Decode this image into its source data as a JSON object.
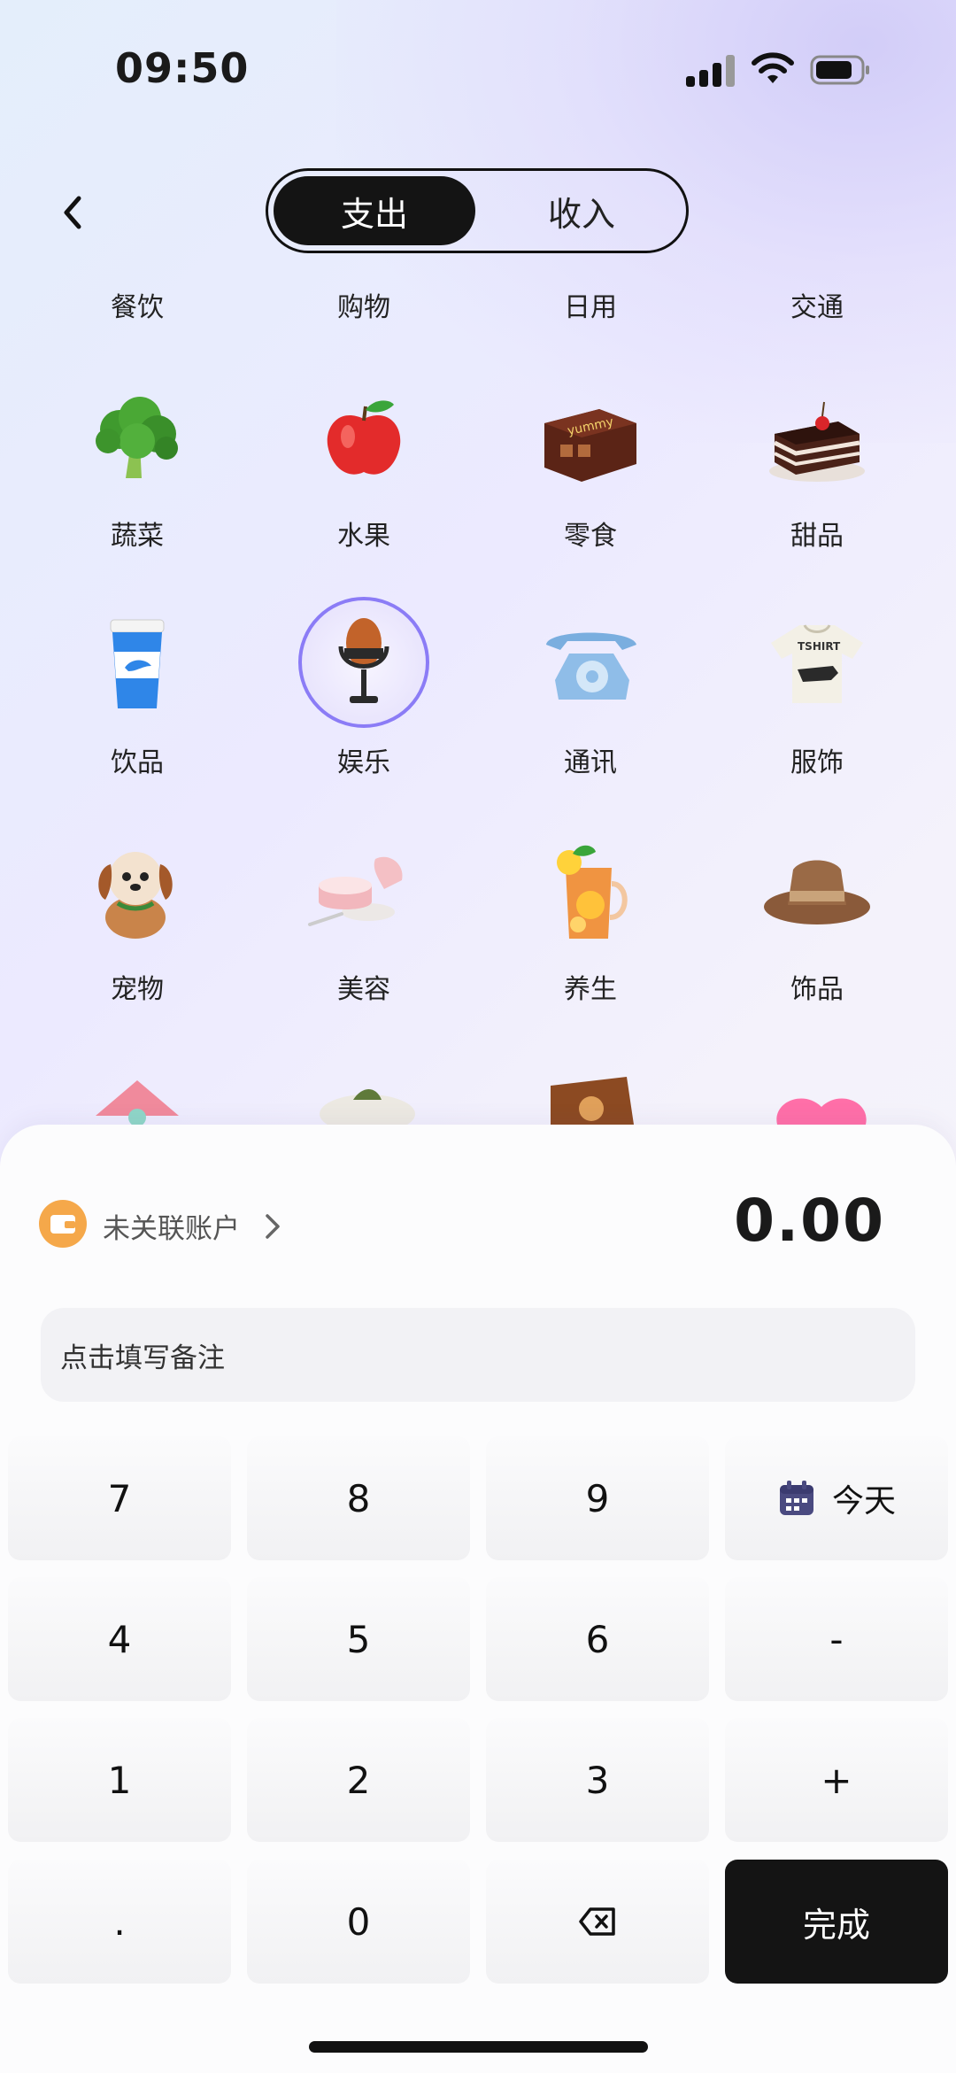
{
  "status": {
    "time": "09:50"
  },
  "segment": {
    "expense": "支出",
    "income": "收入"
  },
  "top_categories": [
    "餐饮",
    "购物",
    "日用",
    "交通"
  ],
  "categories": [
    {
      "label": "蔬菜",
      "icon": "broccoli-icon"
    },
    {
      "label": "水果",
      "icon": "apple-icon"
    },
    {
      "label": "零食",
      "icon": "snack-box-icon"
    },
    {
      "label": "甜品",
      "icon": "cake-icon"
    },
    {
      "label": "饮品",
      "icon": "coffee-cup-icon"
    },
    {
      "label": "娱乐",
      "icon": "microphone-icon"
    },
    {
      "label": "通讯",
      "icon": "telephone-icon"
    },
    {
      "label": "服饰",
      "icon": "tshirt-icon"
    },
    {
      "label": "宠物",
      "icon": "puppy-icon"
    },
    {
      "label": "美容",
      "icon": "cosmetics-icon"
    },
    {
      "label": "养生",
      "icon": "herbal-tea-icon"
    },
    {
      "label": "饰品",
      "icon": "hat-icon"
    }
  ],
  "selected_category": "娱乐",
  "partial_row_icons": [
    "house-icon",
    "sofa-icon",
    "book-icon",
    "heart-icon"
  ],
  "tshirt_text": "TSHIRT",
  "snack_text": "yummy",
  "account": {
    "label": "未关联账户"
  },
  "amount": "0.00",
  "note_placeholder": "点击填写备注",
  "keypad": {
    "k7": "7",
    "k8": "8",
    "k9": "9",
    "date": "今天",
    "k4": "4",
    "k5": "5",
    "k6": "6",
    "minus": "-",
    "k1": "1",
    "k2": "2",
    "k3": "3",
    "plus": "+",
    "dot": ".",
    "k0": "0",
    "done": "完成"
  },
  "colors": {
    "accent_dark": "#141414",
    "selected_ring": "#8b7cf6",
    "wallet": "#f5a84a",
    "calendar": "#4a4a80"
  }
}
